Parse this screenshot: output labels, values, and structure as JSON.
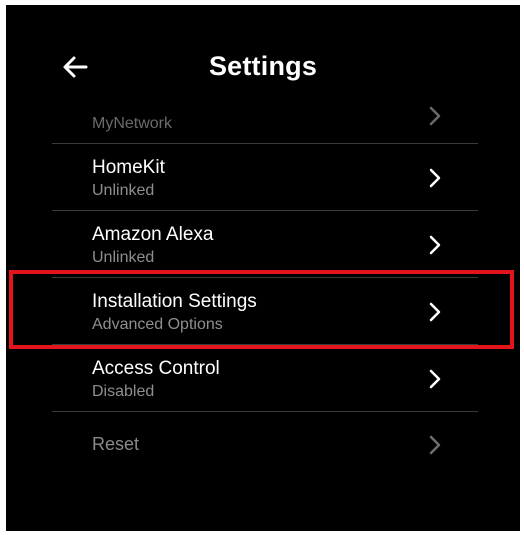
{
  "header": {
    "title": "Settings",
    "back_icon": "arrow-left-icon"
  },
  "items": [
    {
      "title": "",
      "subtitle": "MyNetwork",
      "icon": "chevron-right-icon",
      "state": "partially-scrolled"
    },
    {
      "title": "HomeKit",
      "subtitle": "Unlinked",
      "icon": "chevron-right-icon"
    },
    {
      "title": "Amazon Alexa",
      "subtitle": "Unlinked",
      "icon": "chevron-right-icon"
    },
    {
      "title": "Installation Settings",
      "subtitle": "Advanced Options",
      "icon": "chevron-right-icon",
      "highlighted": true
    },
    {
      "title": "Access Control",
      "subtitle": "Disabled",
      "icon": "chevron-right-icon"
    },
    {
      "title": "Reset",
      "subtitle": "",
      "icon": "chevron-right-icon",
      "state": "dimmed"
    }
  ],
  "colors": {
    "background": "#000000",
    "text": "#ffffff",
    "subtext": "#8f8f8f",
    "divider": "#3a3a3a",
    "highlight_border": "#e3141c"
  }
}
